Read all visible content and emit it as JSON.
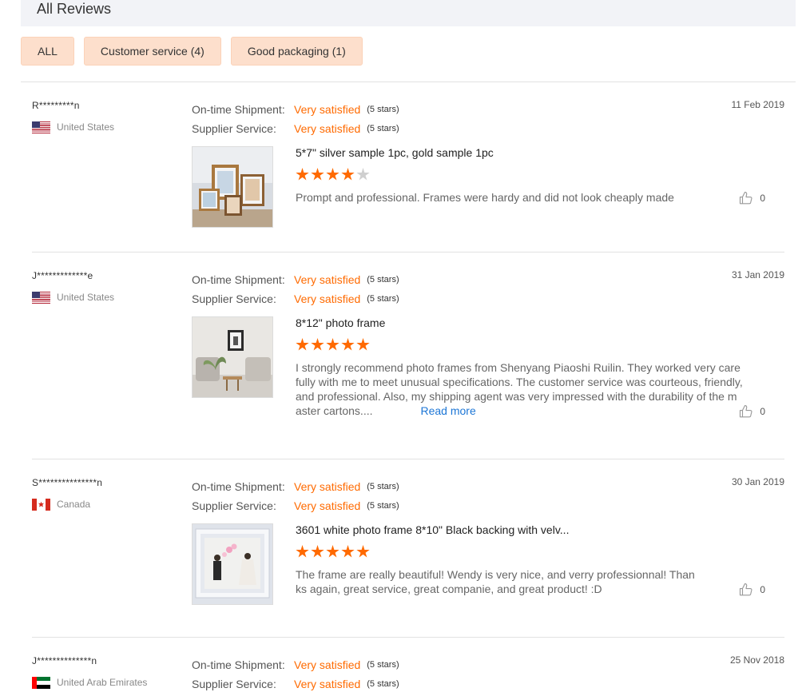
{
  "header": {
    "title": "All Reviews"
  },
  "filters": [
    {
      "label": "ALL"
    },
    {
      "label": "Customer service (4)"
    },
    {
      "label": "Good packaging (1)"
    }
  ],
  "rating_labels": {
    "shipment": "On-time Shipment:",
    "service": "Supplier Service:"
  },
  "reviews": [
    {
      "user": "R*********n",
      "country": "United States",
      "flag_icon": "us-flag-icon",
      "date": "11 Feb 2019",
      "shipment_value": "Very satisfied",
      "shipment_stars": "(5 stars)",
      "service_value": "Very satisfied",
      "service_stars": "(5 stars)",
      "product": "5*7\" silver sample 1pc, gold sample 1pc",
      "rating": 4,
      "comment": "Prompt and professional. Frames were hardy and did not look cheaply made",
      "likes": "0"
    },
    {
      "user": "J*************e",
      "country": "United States",
      "flag_icon": "us-flag-icon",
      "date": "31 Jan 2019",
      "shipment_value": "Very satisfied",
      "shipment_stars": "(5 stars)",
      "service_value": "Very satisfied",
      "service_stars": "(5 stars)",
      "product": "8*12\" photo frame",
      "rating": 5,
      "comment": "I strongly recommend photo frames from Shenyang Piaoshi Ruilin. They worked very carefully with me to meet unusual specifications. The customer service was courteous, friendly, and professional. Also, my shipping agent was very impressed with the durability of the master cartons....",
      "read_more": "Read more",
      "likes": "0"
    },
    {
      "user": "S***************n",
      "country": "Canada",
      "flag_icon": "canada-flag-icon",
      "date": "30 Jan 2019",
      "shipment_value": "Very satisfied",
      "shipment_stars": "(5 stars)",
      "service_value": "Very satisfied",
      "service_stars": "(5 stars)",
      "product": "3601 white photo frame 8*10\" Black backing with velv...",
      "rating": 5,
      "comment": "The frame are really beautiful! Wendy is very nice, and verry professionnal! Thanks again, great service, great companie, and great product! :D",
      "likes": "0"
    },
    {
      "user": "J**************n",
      "country": "United Arab Emirates",
      "flag_icon": "uae-flag-icon",
      "date": "25 Nov 2018",
      "shipment_value": "Very satisfied",
      "shipment_stars": "(5 stars)",
      "service_value": "Very satisfied",
      "service_stars": "(5 stars)"
    }
  ],
  "colors": {
    "accent": "#ff6a00",
    "chip_bg": "#fddfcc",
    "link": "#1c76d6"
  }
}
